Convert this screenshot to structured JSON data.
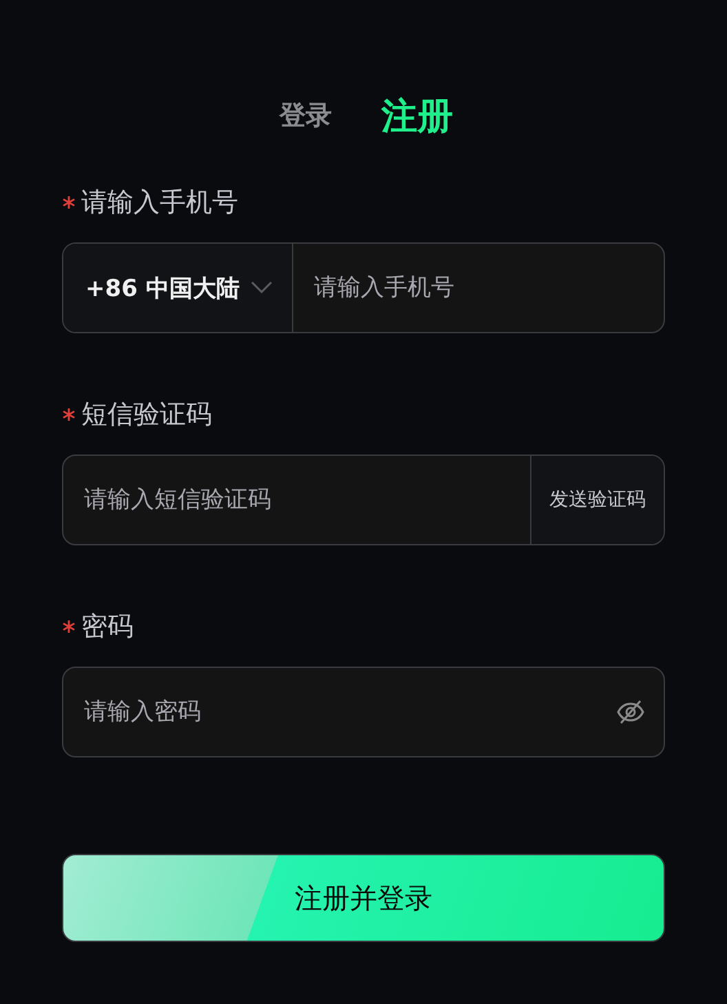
{
  "tabs": [
    {
      "label": "登录",
      "selected": false
    },
    {
      "label": "注册",
      "selected": true
    }
  ],
  "fields": [
    {
      "kind": "phone",
      "label": "请输入手机号",
      "required": true,
      "country": "+86 中国大陆",
      "placeholder": "请输入手机号"
    },
    {
      "kind": "code",
      "label": "短信验证码",
      "required": true,
      "placeholder": "请输入短信验证码",
      "action": "发送验证码"
    },
    {
      "kind": "password",
      "label": "密码",
      "required": true,
      "placeholder": "请输入密码"
    }
  ],
  "submit": "注册并登录"
}
